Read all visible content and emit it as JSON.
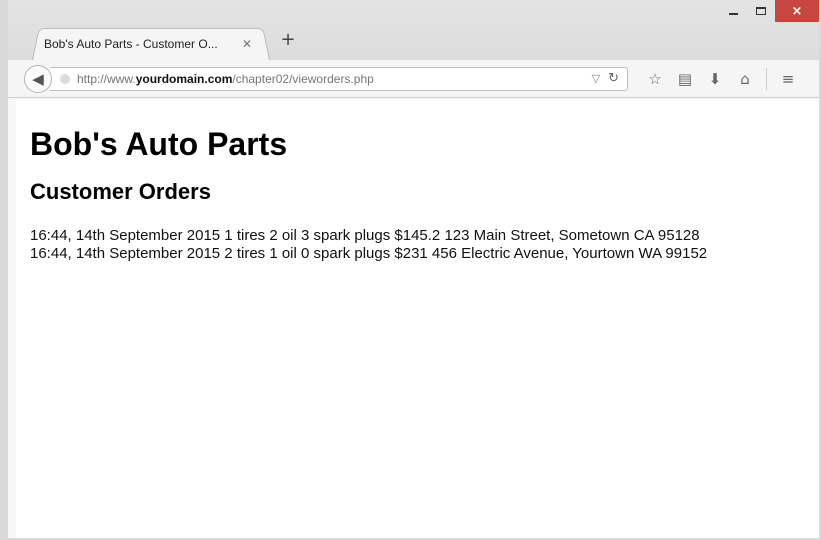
{
  "browser": {
    "tab": {
      "title": "Bob's Auto Parts - Customer O...",
      "close_icon": "close-icon"
    },
    "new_tab_label": "+",
    "window_controls": {
      "close_label": "×"
    },
    "address_bar": {
      "url_prefix": "http://www.",
      "url_domain": "yourdomain.com",
      "url_path": "/chapter02/vieworders.php"
    },
    "toolbar_icons": [
      "star-icon",
      "reading-list-icon",
      "download-icon",
      "home-icon",
      "menu-icon"
    ]
  },
  "page": {
    "heading": "Bob's Auto Parts",
    "subheading": "Customer Orders",
    "orders": [
      "16:44, 14th September 2015 1 tires 2 oil 3 spark plugs $145.2 123 Main Street, Sometown CA 95128",
      "16:44, 14th September 2015 2 tires 1 oil 0 spark plugs $231 456 Electric Avenue, Yourtown WA 99152"
    ]
  }
}
